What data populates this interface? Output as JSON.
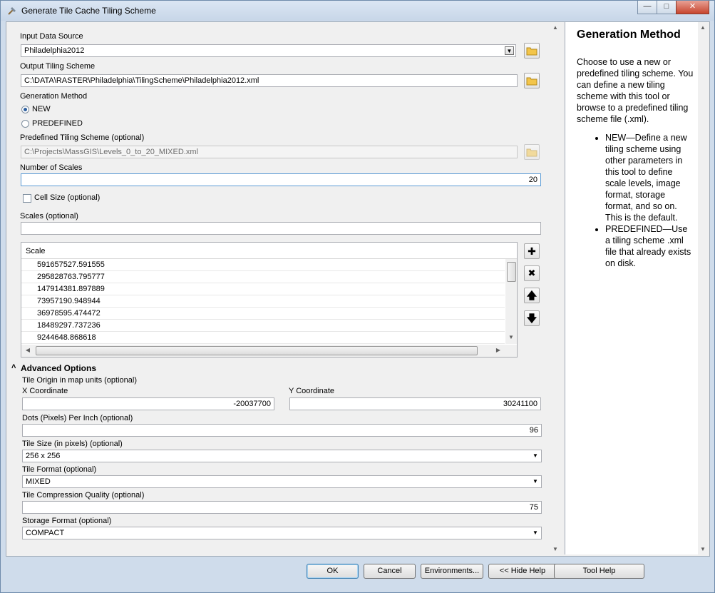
{
  "window": {
    "title": "Generate Tile Cache Tiling Scheme"
  },
  "input_data_source": {
    "label": "Input Data Source",
    "value": "Philadelphia2012"
  },
  "output_tiling_scheme": {
    "label": "Output Tiling Scheme",
    "value": "C:\\DATA\\RASTER\\Philadelphia\\TilingScheme\\Philadelphia2012.xml"
  },
  "generation_method": {
    "label": "Generation Method",
    "options": [
      "NEW",
      "PREDEFINED"
    ],
    "selected": "NEW"
  },
  "predefined_scheme": {
    "label": "Predefined Tiling Scheme (optional)",
    "value": "C:\\Projects\\MassGIS\\Levels_0_to_20_MIXED.xml"
  },
  "number_of_scales": {
    "label": "Number of Scales",
    "value": "20"
  },
  "cell_size": {
    "label": "Cell Size (optional)",
    "checked": false
  },
  "scales": {
    "label": "Scales (optional)",
    "input_value": "",
    "column_header": "Scale",
    "rows": [
      "591657527.591555",
      "295828763.795777",
      "147914381.897889",
      "73957190.948944",
      "36978595.474472",
      "18489297.737236",
      "9244648.868618"
    ]
  },
  "advanced": {
    "label": "Advanced Options",
    "tile_origin_label": "Tile Origin in map units (optional)",
    "x_label": "X Coordinate",
    "x_value": "-20037700",
    "y_label": "Y Coordinate",
    "y_value": "30241100",
    "dpi_label": "Dots (Pixels) Per Inch (optional)",
    "dpi_value": "96",
    "tile_size_label": "Tile Size (in pixels) (optional)",
    "tile_size_value": "256 x 256",
    "tile_format_label": "Tile Format (optional)",
    "tile_format_value": "MIXED",
    "compression_label": "Tile Compression Quality (optional)",
    "compression_value": "75",
    "storage_label": "Storage Format (optional)",
    "storage_value": "COMPACT"
  },
  "help": {
    "title": "Generation Method",
    "intro": "Choose to use a new or predefined tiling scheme. You can define a new tiling scheme with this tool or browse to a predefined tiling scheme file (.xml).",
    "bullets": [
      "NEW—Define a new tiling scheme using other parameters in this tool to define scale levels, image format, storage format, and so on. This is the default.",
      "PREDEFINED—Use a tiling scheme .xml file that already exists on disk."
    ]
  },
  "buttons": {
    "ok": "OK",
    "cancel": "Cancel",
    "environments": "Environments...",
    "hide_help": "<< Hide Help",
    "tool_help": "Tool Help"
  },
  "colors": {
    "accent": "#2d5fa0",
    "title_bar": "#c7d6e8"
  }
}
